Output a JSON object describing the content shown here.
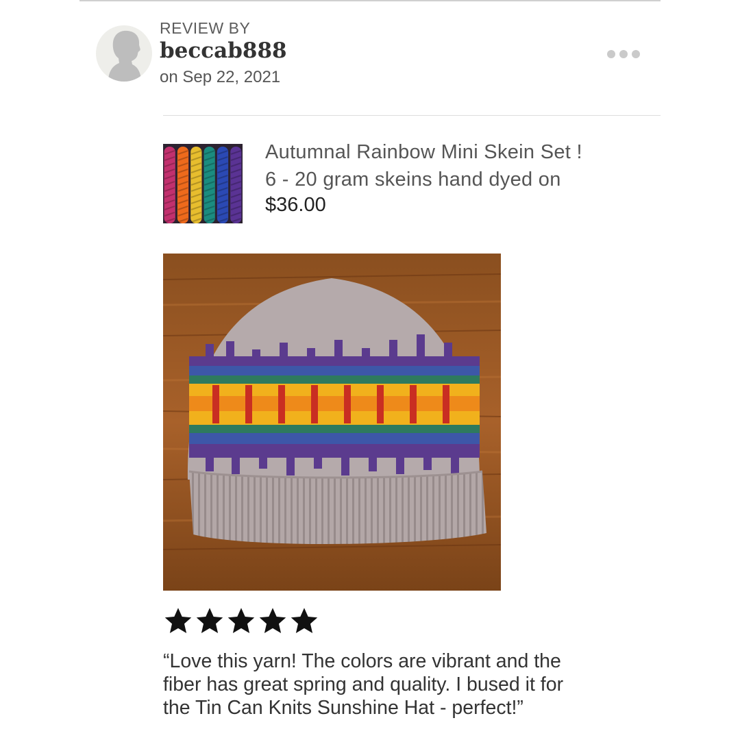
{
  "review": {
    "heading": "REVIEW BY",
    "username": "beccab888",
    "date": "on Sep 22, 2021",
    "rating": 5,
    "text_lines": [
      "“Love this yarn! The colors are vibrant and the",
      "fiber has great spring and quality. I bused it for",
      "the Tin Can Knits Sunshine Hat - perfect!”"
    ]
  },
  "product": {
    "title_lines": [
      "Autumnal Rainbow Mini Skein Set !",
      "6 - 20 gram skeins hand dyed on"
    ],
    "price": "$36.00",
    "skein_colors": [
      "#c2306e",
      "#ee6a1c",
      "#e7bd2e",
      "#1b8c80",
      "#2b49b4",
      "#5a3394"
    ]
  },
  "icons": {
    "avatar": "avatar-silhouette-icon",
    "more": "more-options-icon",
    "star": "star-icon"
  }
}
